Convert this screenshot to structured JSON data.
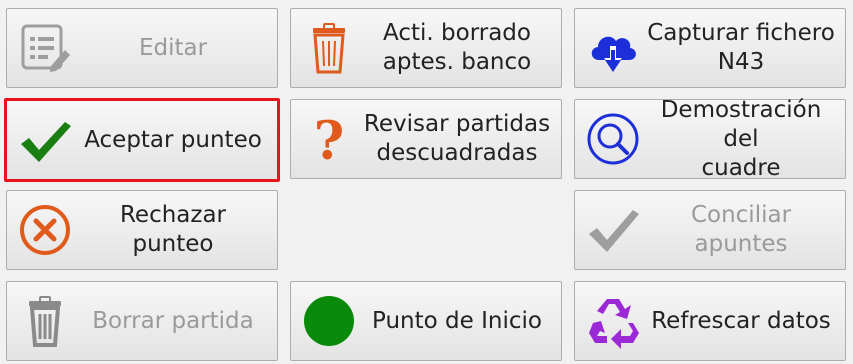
{
  "buttons": {
    "editar": {
      "label": "Editar",
      "enabled": false,
      "icon": "edit-icon"
    },
    "activar_borrado": {
      "label": "Acti. borrado\naptes. banco",
      "enabled": true,
      "icon": "trash-orange-icon"
    },
    "capturar": {
      "label": "Capturar fichero\nN43",
      "enabled": true,
      "icon": "cloud-download-icon"
    },
    "aceptar": {
      "label": "Aceptar punteo",
      "enabled": true,
      "selected": true,
      "icon": "check-green-icon"
    },
    "revisar": {
      "label": "Revisar partidas\ndescuadradas",
      "enabled": true,
      "icon": "question-red-icon"
    },
    "demostracion": {
      "label": "Demostración del\ncuadre",
      "enabled": true,
      "icon": "magnifier-icon"
    },
    "rechazar": {
      "label": "Rechazar punteo",
      "enabled": true,
      "icon": "x-circle-icon"
    },
    "conciliar": {
      "label": "Conciliar apuntes",
      "enabled": false,
      "icon": "check-gray-icon"
    },
    "borrar": {
      "label": "Borrar partida",
      "enabled": false,
      "icon": "trash-gray-icon"
    },
    "punto_inicio": {
      "label": "Punto de Inicio",
      "enabled": true,
      "icon": "green-circle-icon"
    },
    "refrescar": {
      "label": "Refrescar datos",
      "enabled": true,
      "icon": "recycle-icon"
    }
  },
  "colors": {
    "selected_border": "#e8141b",
    "green": "#1a7f12",
    "orange": "#e05a1c",
    "blue": "#1d2fd8",
    "purple": "#9b2ad6",
    "disabled_text": "#9a9a9a"
  }
}
